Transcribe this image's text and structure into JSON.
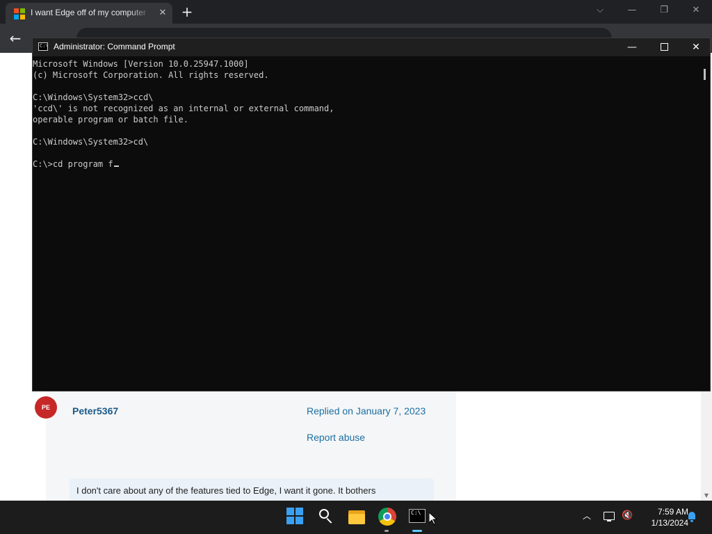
{
  "browser": {
    "tab_title": "I want Edge off of my computer",
    "close_glyph": "✕",
    "new_tab_glyph": "+",
    "back_glyph": "←",
    "ctl_glyphs": {
      "tab_search": "⌵",
      "minimize": "—",
      "restore": "❐",
      "close": "✕"
    }
  },
  "webpage": {
    "avatar_initials": "PE",
    "username": "Peter5367",
    "replied_on": "Replied on January 7, 2023",
    "report_abuse": "Report abuse",
    "post_text": "I don't care about any of the features tied to Edge, I want it gone. It bothers",
    "scroll_down_glyph": "▼",
    "colors": {
      "link": "#1a6fa3",
      "avatar_bg": "#c62828"
    }
  },
  "cmd": {
    "title": "Administrator: Command Prompt",
    "icon_text": "C:\\",
    "buttons": {
      "minimize": "—",
      "close": "✕"
    },
    "lines": [
      "Microsoft Windows [Version 10.0.25947.1000]",
      "(c) Microsoft Corporation. All rights reserved.",
      "",
      "C:\\Windows\\System32>ccd\\",
      "'ccd\\' is not recognized as an internal or external command,",
      "operable program or batch file.",
      "",
      "C:\\Windows\\System32>cd\\",
      "",
      "C:\\>cd program f"
    ]
  },
  "taskbar": {
    "icons": [
      "windows-start-icon",
      "search-icon",
      "file-explorer-icon",
      "chrome-icon",
      "terminal-icon"
    ],
    "tray_chevron": "︿",
    "volume_glyph": "🔇",
    "clock_time": "7:59 AM",
    "clock_date": "1/13/2024"
  }
}
